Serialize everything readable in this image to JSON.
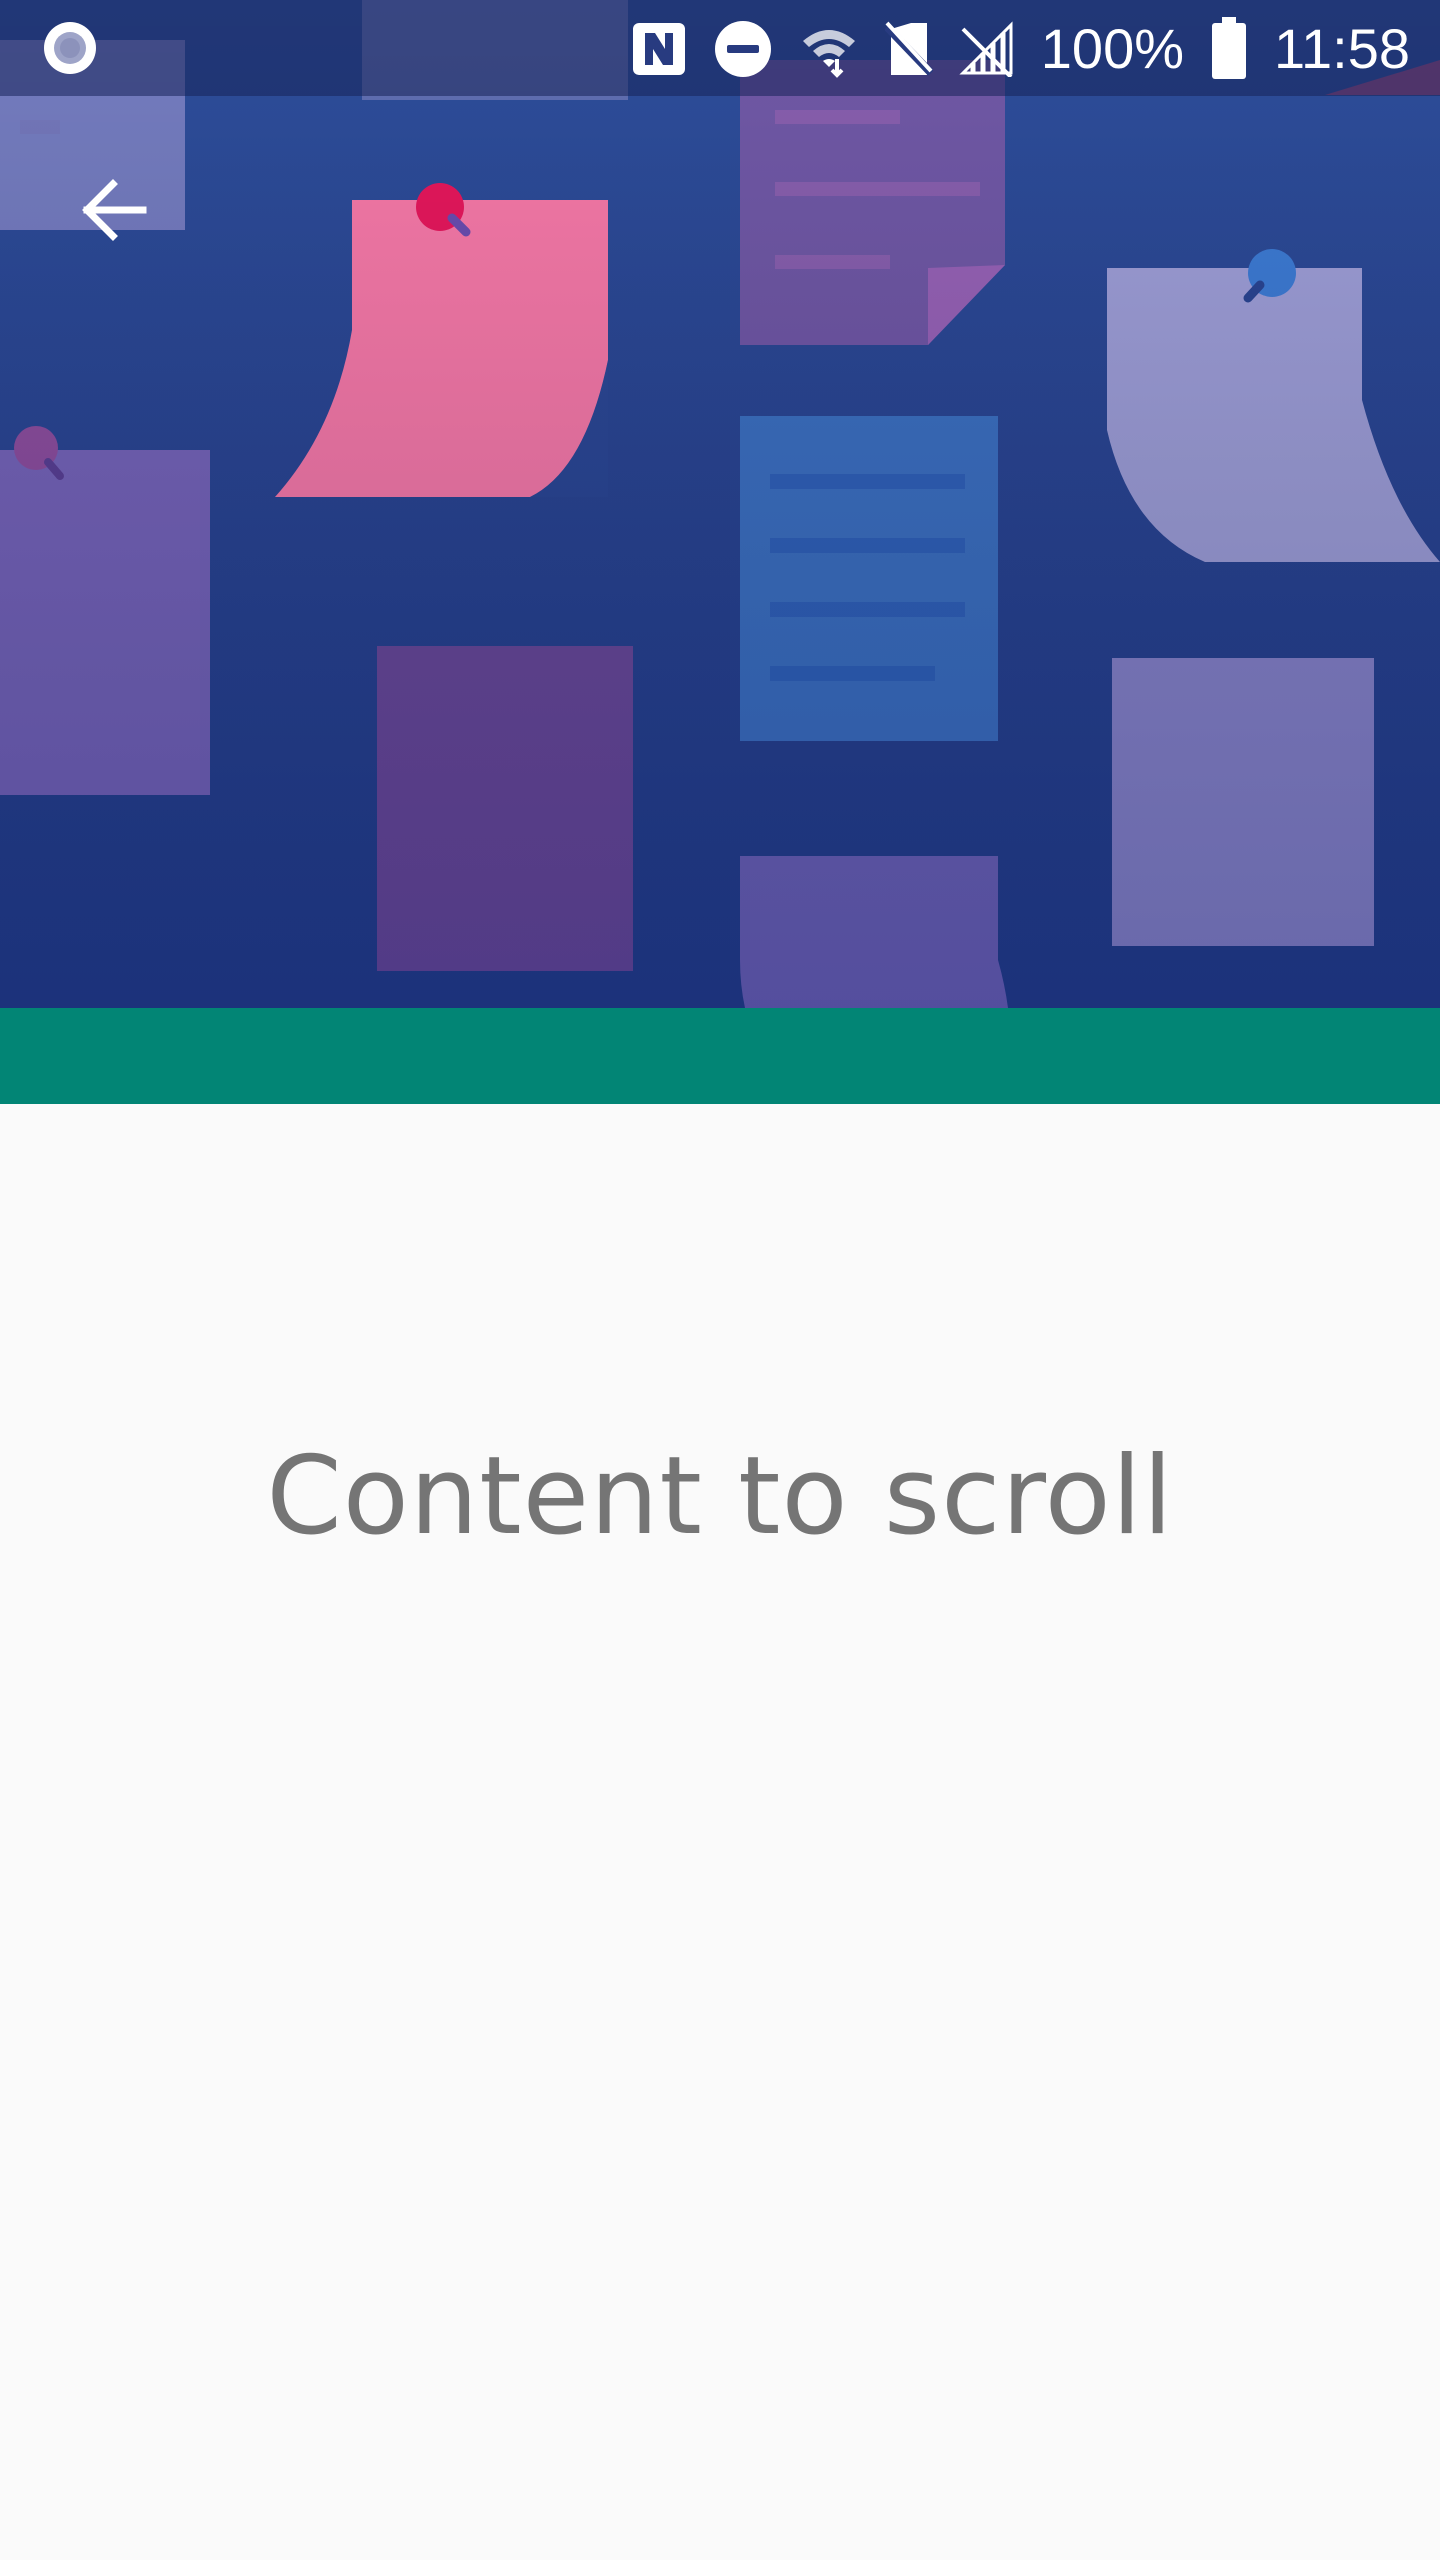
{
  "status_bar": {
    "battery_percent": "100%",
    "time": "11:58",
    "icons": [
      "record-icon",
      "nfc-icon",
      "do-not-disturb-icon",
      "wifi-icon",
      "no-sim-icon",
      "cellular-signal-icon",
      "battery-icon"
    ]
  },
  "app_bar": {
    "back_icon": "arrow-back-icon"
  },
  "colors": {
    "hero_background": "#2a4592",
    "teal_bar": "#028575",
    "content_background": "#fafafa",
    "content_text": "#757575"
  },
  "content": {
    "text": "Content to scroll"
  }
}
